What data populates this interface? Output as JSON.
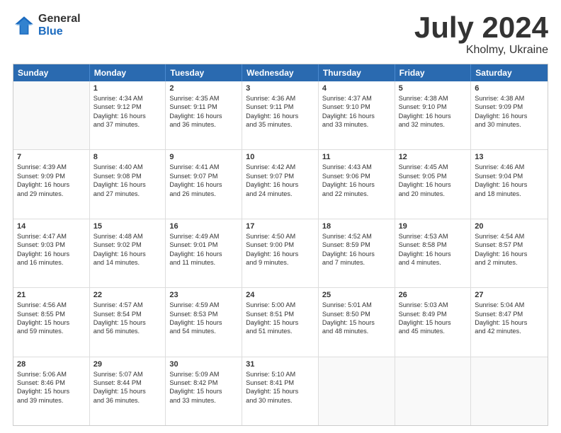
{
  "logo": {
    "general": "General",
    "blue": "Blue"
  },
  "title": {
    "month": "July 2024",
    "location": "Kholmy, Ukraine"
  },
  "calendar": {
    "headers": [
      "Sunday",
      "Monday",
      "Tuesday",
      "Wednesday",
      "Thursday",
      "Friday",
      "Saturday"
    ],
    "rows": [
      [
        {
          "day": "",
          "lines": []
        },
        {
          "day": "1",
          "lines": [
            "Sunrise: 4:34 AM",
            "Sunset: 9:12 PM",
            "Daylight: 16 hours",
            "and 37 minutes."
          ]
        },
        {
          "day": "2",
          "lines": [
            "Sunrise: 4:35 AM",
            "Sunset: 9:11 PM",
            "Daylight: 16 hours",
            "and 36 minutes."
          ]
        },
        {
          "day": "3",
          "lines": [
            "Sunrise: 4:36 AM",
            "Sunset: 9:11 PM",
            "Daylight: 16 hours",
            "and 35 minutes."
          ]
        },
        {
          "day": "4",
          "lines": [
            "Sunrise: 4:37 AM",
            "Sunset: 9:10 PM",
            "Daylight: 16 hours",
            "and 33 minutes."
          ]
        },
        {
          "day": "5",
          "lines": [
            "Sunrise: 4:38 AM",
            "Sunset: 9:10 PM",
            "Daylight: 16 hours",
            "and 32 minutes."
          ]
        },
        {
          "day": "6",
          "lines": [
            "Sunrise: 4:38 AM",
            "Sunset: 9:09 PM",
            "Daylight: 16 hours",
            "and 30 minutes."
          ]
        }
      ],
      [
        {
          "day": "7",
          "lines": [
            "Sunrise: 4:39 AM",
            "Sunset: 9:09 PM",
            "Daylight: 16 hours",
            "and 29 minutes."
          ]
        },
        {
          "day": "8",
          "lines": [
            "Sunrise: 4:40 AM",
            "Sunset: 9:08 PM",
            "Daylight: 16 hours",
            "and 27 minutes."
          ]
        },
        {
          "day": "9",
          "lines": [
            "Sunrise: 4:41 AM",
            "Sunset: 9:07 PM",
            "Daylight: 16 hours",
            "and 26 minutes."
          ]
        },
        {
          "day": "10",
          "lines": [
            "Sunrise: 4:42 AM",
            "Sunset: 9:07 PM",
            "Daylight: 16 hours",
            "and 24 minutes."
          ]
        },
        {
          "day": "11",
          "lines": [
            "Sunrise: 4:43 AM",
            "Sunset: 9:06 PM",
            "Daylight: 16 hours",
            "and 22 minutes."
          ]
        },
        {
          "day": "12",
          "lines": [
            "Sunrise: 4:45 AM",
            "Sunset: 9:05 PM",
            "Daylight: 16 hours",
            "and 20 minutes."
          ]
        },
        {
          "day": "13",
          "lines": [
            "Sunrise: 4:46 AM",
            "Sunset: 9:04 PM",
            "Daylight: 16 hours",
            "and 18 minutes."
          ]
        }
      ],
      [
        {
          "day": "14",
          "lines": [
            "Sunrise: 4:47 AM",
            "Sunset: 9:03 PM",
            "Daylight: 16 hours",
            "and 16 minutes."
          ]
        },
        {
          "day": "15",
          "lines": [
            "Sunrise: 4:48 AM",
            "Sunset: 9:02 PM",
            "Daylight: 16 hours",
            "and 14 minutes."
          ]
        },
        {
          "day": "16",
          "lines": [
            "Sunrise: 4:49 AM",
            "Sunset: 9:01 PM",
            "Daylight: 16 hours",
            "and 11 minutes."
          ]
        },
        {
          "day": "17",
          "lines": [
            "Sunrise: 4:50 AM",
            "Sunset: 9:00 PM",
            "Daylight: 16 hours",
            "and 9 minutes."
          ]
        },
        {
          "day": "18",
          "lines": [
            "Sunrise: 4:52 AM",
            "Sunset: 8:59 PM",
            "Daylight: 16 hours",
            "and 7 minutes."
          ]
        },
        {
          "day": "19",
          "lines": [
            "Sunrise: 4:53 AM",
            "Sunset: 8:58 PM",
            "Daylight: 16 hours",
            "and 4 minutes."
          ]
        },
        {
          "day": "20",
          "lines": [
            "Sunrise: 4:54 AM",
            "Sunset: 8:57 PM",
            "Daylight: 16 hours",
            "and 2 minutes."
          ]
        }
      ],
      [
        {
          "day": "21",
          "lines": [
            "Sunrise: 4:56 AM",
            "Sunset: 8:55 PM",
            "Daylight: 15 hours",
            "and 59 minutes."
          ]
        },
        {
          "day": "22",
          "lines": [
            "Sunrise: 4:57 AM",
            "Sunset: 8:54 PM",
            "Daylight: 15 hours",
            "and 56 minutes."
          ]
        },
        {
          "day": "23",
          "lines": [
            "Sunrise: 4:59 AM",
            "Sunset: 8:53 PM",
            "Daylight: 15 hours",
            "and 54 minutes."
          ]
        },
        {
          "day": "24",
          "lines": [
            "Sunrise: 5:00 AM",
            "Sunset: 8:51 PM",
            "Daylight: 15 hours",
            "and 51 minutes."
          ]
        },
        {
          "day": "25",
          "lines": [
            "Sunrise: 5:01 AM",
            "Sunset: 8:50 PM",
            "Daylight: 15 hours",
            "and 48 minutes."
          ]
        },
        {
          "day": "26",
          "lines": [
            "Sunrise: 5:03 AM",
            "Sunset: 8:49 PM",
            "Daylight: 15 hours",
            "and 45 minutes."
          ]
        },
        {
          "day": "27",
          "lines": [
            "Sunrise: 5:04 AM",
            "Sunset: 8:47 PM",
            "Daylight: 15 hours",
            "and 42 minutes."
          ]
        }
      ],
      [
        {
          "day": "28",
          "lines": [
            "Sunrise: 5:06 AM",
            "Sunset: 8:46 PM",
            "Daylight: 15 hours",
            "and 39 minutes."
          ]
        },
        {
          "day": "29",
          "lines": [
            "Sunrise: 5:07 AM",
            "Sunset: 8:44 PM",
            "Daylight: 15 hours",
            "and 36 minutes."
          ]
        },
        {
          "day": "30",
          "lines": [
            "Sunrise: 5:09 AM",
            "Sunset: 8:42 PM",
            "Daylight: 15 hours",
            "and 33 minutes."
          ]
        },
        {
          "day": "31",
          "lines": [
            "Sunrise: 5:10 AM",
            "Sunset: 8:41 PM",
            "Daylight: 15 hours",
            "and 30 minutes."
          ]
        },
        {
          "day": "",
          "lines": []
        },
        {
          "day": "",
          "lines": []
        },
        {
          "day": "",
          "lines": []
        }
      ]
    ]
  }
}
